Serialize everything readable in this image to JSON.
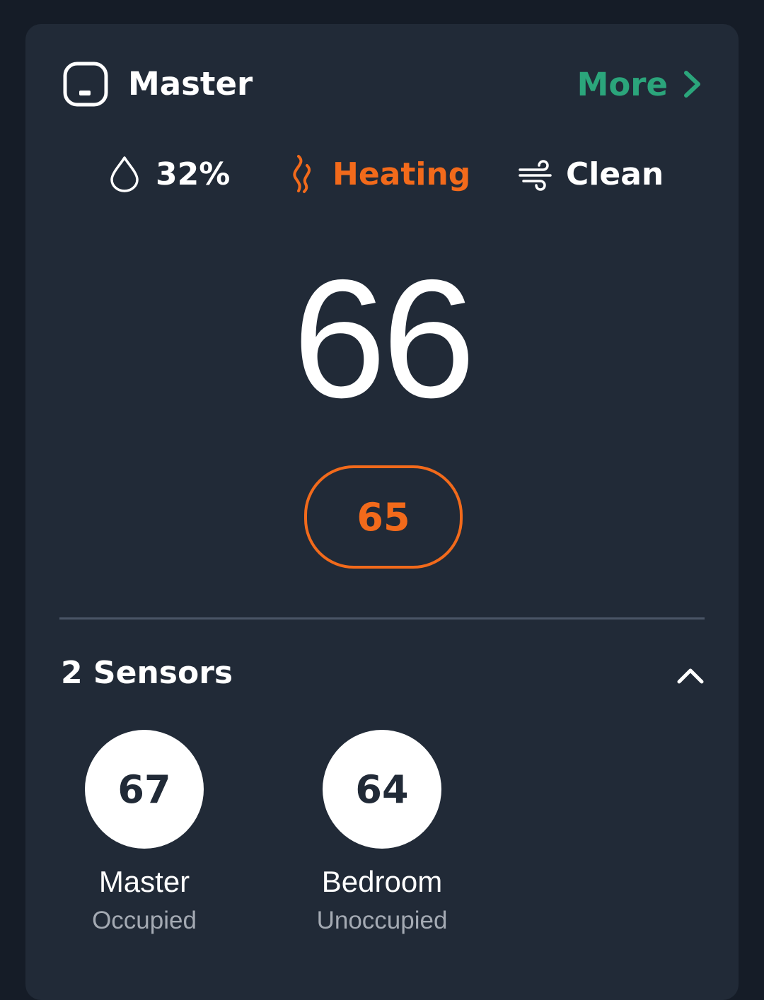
{
  "thermostat": {
    "name": "Master",
    "more_label": "More",
    "humidity": "32%",
    "mode": "Heating",
    "air_quality": "Clean",
    "current_temp": "66",
    "setpoint": "65"
  },
  "sensors": {
    "title": "2 Sensors",
    "items": [
      {
        "temp": "67",
        "name": "Master",
        "status": "Occupied"
      },
      {
        "temp": "64",
        "name": "Bedroom",
        "status": "Unoccupied"
      }
    ]
  },
  "colors": {
    "background": "#151c27",
    "card": "#212a37",
    "accent_green": "#2ba57b",
    "heating_orange": "#f26a1b",
    "secondary_text": "#a4aab3"
  },
  "icons": {
    "device": "thermostat-device-icon",
    "more": "chevron-right-icon",
    "humidity": "water-drop-icon",
    "heating": "flame-icon",
    "air": "wind-icon",
    "collapse": "chevron-up-icon"
  }
}
